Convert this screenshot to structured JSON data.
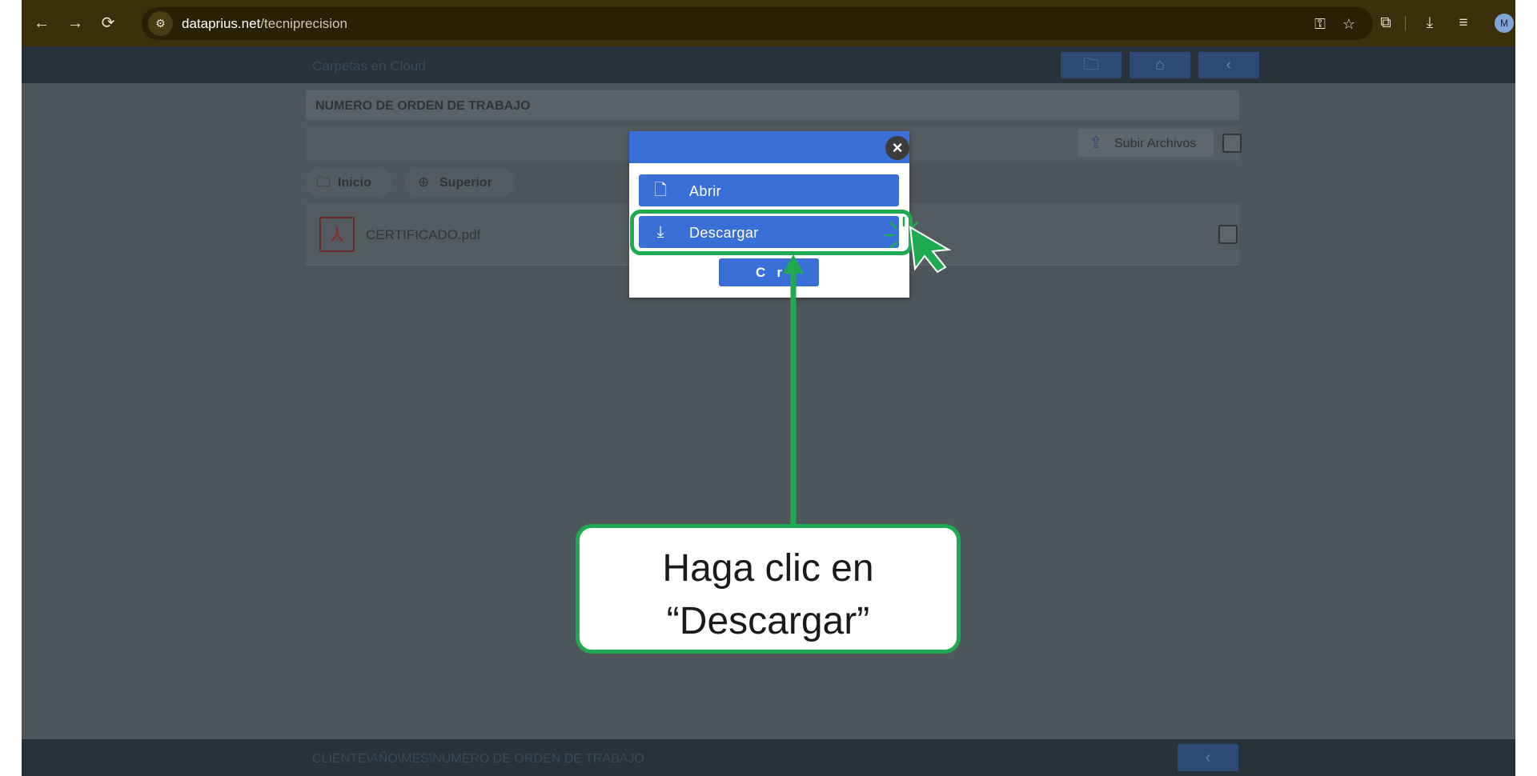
{
  "browser": {
    "url_host": "dataprius.net",
    "url_path": "/tecniprecision",
    "profile_initial": "M",
    "icons": [
      "back-icon",
      "forward-icon",
      "reload-icon",
      "site-info-icon",
      "password-key-icon",
      "bookmark-star-icon",
      "extensions-icon",
      "downloads-icon",
      "reading-list-icon"
    ]
  },
  "app": {
    "title": "Carpetas en Cloud",
    "folder_name": "NUMERO DE ORDEN DE TRABAJO",
    "upload_label": "Subir Archivos",
    "breadcrumbs": [
      {
        "label": "Inicio",
        "icon": "folder-icon"
      },
      {
        "label": "Superior",
        "icon": "up-arrow-icon"
      }
    ],
    "files": [
      {
        "name": "CERTIFICADO.pdf",
        "icon": "pdf-icon"
      }
    ],
    "footer_path": "CLIENTE\\AÑO\\MES\\NUMERO DE ORDEN DE TRABAJO"
  },
  "modal": {
    "open_label": "Abrir",
    "download_label": "Descargar",
    "cancel_label": "C   r"
  },
  "tutorial": {
    "callout_text": "Haga clic en “Descargar”"
  },
  "colors": {
    "accent_blue": "#3a6fd8",
    "highlight_green": "#1faa4f",
    "browser_bar": "#3b2f0c"
  }
}
